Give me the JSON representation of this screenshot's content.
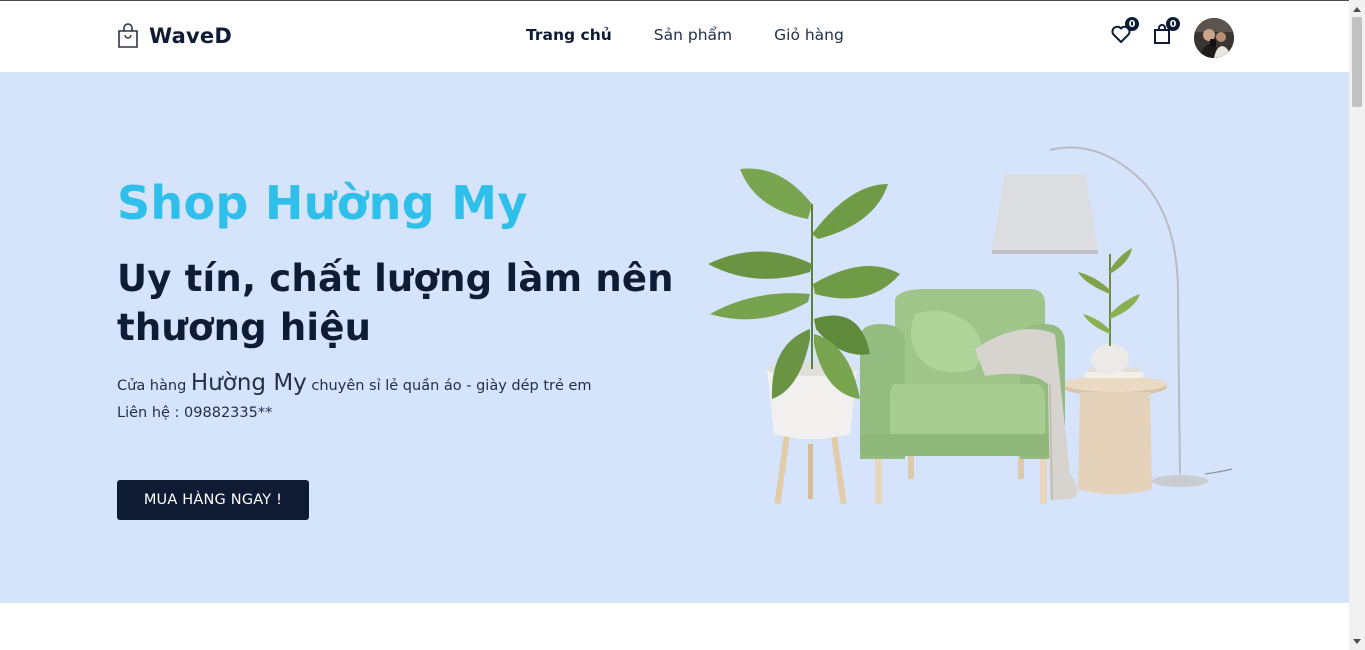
{
  "header": {
    "logo_text": "WaveD",
    "nav": [
      {
        "label": "Trang chủ",
        "active": true
      },
      {
        "label": "Sản phẩm",
        "active": false
      },
      {
        "label": "Giỏ hàng",
        "active": false
      }
    ],
    "wishlist_count": "0",
    "cart_count": "0",
    "icons": [
      "shopping-bag-icon",
      "heart-icon",
      "cart-bag-icon",
      "user-avatar"
    ]
  },
  "hero": {
    "brand": "Shop Hường My",
    "title": "Uy tín, chất lượng làm nên thương hiệu",
    "desc_prefix": "Cửa hàng ",
    "desc_highlight": "Hường My",
    "desc_suffix": " chuyên sỉ lẻ quần áo - giày dép trẻ em",
    "contact": "Liên hệ : 09882335**",
    "cta_label": "MUA HÀNG NGAY !",
    "image_alt": "green armchair with plants and floor lamp"
  },
  "colors": {
    "hero_bg": "#d5e3fb",
    "brand_cyan": "#2ec0ea",
    "navy": "#0f1b33",
    "white": "#ffffff"
  }
}
